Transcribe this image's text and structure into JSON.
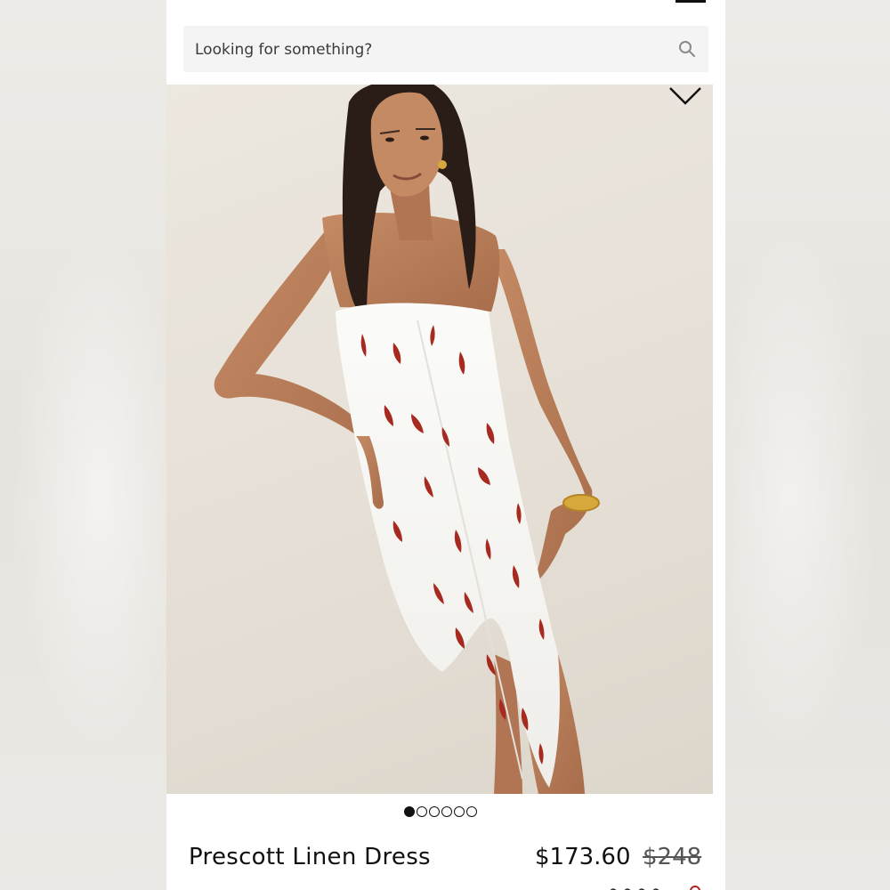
{
  "search": {
    "placeholder": "Looking for something?",
    "icon": "search-icon"
  },
  "product": {
    "image_alt": "Model wearing white strapless linen dress with red chili pepper print",
    "name": "Prescott Linen Dress",
    "sale_price": "$173.60",
    "original_price": "$248"
  },
  "carousel": {
    "total_images": 6,
    "active_index": 0
  },
  "colors": {
    "text": "#111111",
    "search_bg": "#f4f4f4",
    "accent_red": "#b0231c"
  }
}
